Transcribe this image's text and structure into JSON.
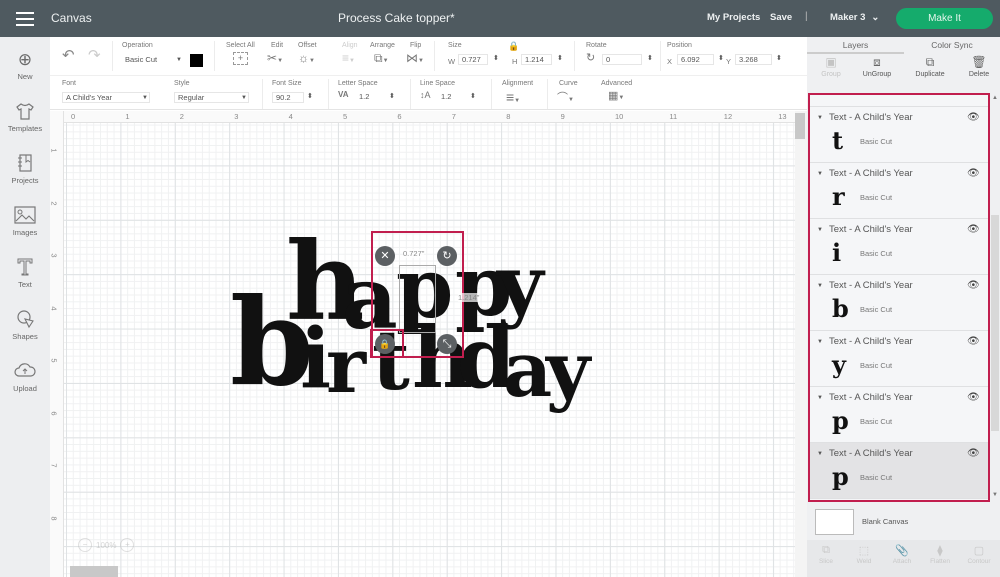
{
  "topbar": {
    "app_title": "Canvas",
    "document_title": "Process Cake topper*",
    "my_projects": "My Projects",
    "save": "Save",
    "separator": "|",
    "machine": "Maker 3",
    "make_it": "Make It",
    "make_it_color": "#15ab6c"
  },
  "sidebar": {
    "items": [
      {
        "label": "New",
        "icon": "plus-circle-icon",
        "glyph": "⊕"
      },
      {
        "label": "Templates",
        "icon": "tshirt-icon",
        "glyph": "👕"
      },
      {
        "label": "Projects",
        "icon": "notebook-icon",
        "glyph": "📓"
      },
      {
        "label": "Images",
        "icon": "image-icon",
        "glyph": "🖼"
      },
      {
        "label": "Text",
        "icon": "text-icon",
        "glyph": "T"
      },
      {
        "label": "Shapes",
        "icon": "shapes-icon",
        "glyph": "⬠"
      },
      {
        "label": "Upload",
        "icon": "cloud-upload-icon",
        "glyph": "☁"
      }
    ]
  },
  "toolbar": {
    "operation_label": "Operation",
    "operation_value": "Basic Cut",
    "operation_color": "#000000",
    "select_all": "Select All",
    "edit": "Edit",
    "offset": "Offset",
    "align": "Align",
    "arrange": "Arrange",
    "flip": "Flip",
    "size_label": "Size",
    "w_label": "W",
    "w_value": "0.727",
    "h_label": "H",
    "h_value": "1.214",
    "rotate_label": "Rotate",
    "rotate_value": "0",
    "position_label": "Position",
    "x_label": "X",
    "x_value": "6.092",
    "y_label": "Y",
    "y_value": "3.268",
    "font_label": "Font",
    "font_value": "A Child's Year",
    "style_label": "Style",
    "style_value": "Regular",
    "font_size_label": "Font Size",
    "font_size_value": "90.2",
    "letter_space_label": "Letter Space",
    "letter_space_value": "1.2",
    "line_space_label": "Line Space",
    "line_space_value": "1.2",
    "alignment_label": "Alignment",
    "curve_label": "Curve",
    "advanced_label": "Advanced"
  },
  "rulers": {
    "horizontal": [
      "0",
      "1",
      "2",
      "3",
      "4",
      "5",
      "6",
      "7",
      "8",
      "9",
      "10",
      "11",
      "12",
      "13"
    ],
    "vertical": [
      "1",
      "2",
      "3",
      "4",
      "5",
      "6",
      "7",
      "8"
    ]
  },
  "canvas": {
    "line1": [
      "h",
      "a",
      "p",
      "p",
      "y"
    ],
    "line2": [
      "b",
      "i",
      "r",
      "t",
      "h",
      "d",
      "a",
      "y"
    ],
    "selection_width": "0.727\"",
    "selection_height": "1.214\"",
    "zoom_level": "100%"
  },
  "layers_panel": {
    "tabs": [
      "Layers",
      "Color Sync"
    ],
    "actions": [
      {
        "label": "Group",
        "enabled": false
      },
      {
        "label": "UnGroup",
        "enabled": true
      },
      {
        "label": "Duplicate",
        "enabled": true
      },
      {
        "label": "Delete",
        "enabled": true
      }
    ],
    "partial_layer_glyph": "h",
    "layers": [
      {
        "name": "Text - A Child's Year",
        "glyph": "t",
        "operation": "Basic Cut"
      },
      {
        "name": "Text - A Child's Year",
        "glyph": "r",
        "operation": "Basic Cut"
      },
      {
        "name": "Text - A Child's Year",
        "glyph": "i",
        "operation": "Basic Cut"
      },
      {
        "name": "Text - A Child's Year",
        "glyph": "b",
        "operation": "Basic Cut"
      },
      {
        "name": "Text - A Child's Year",
        "glyph": "y",
        "operation": "Basic Cut"
      },
      {
        "name": "Text - A Child's Year",
        "glyph": "p",
        "operation": "Basic Cut"
      },
      {
        "name": "Text - A Child's Year",
        "glyph": "p",
        "operation": "Basic Cut",
        "selected": true
      }
    ],
    "blank_canvas": "Blank Canvas",
    "bottom_actions": [
      "Slice",
      "Weld",
      "Attach",
      "Flatten",
      "Contour"
    ],
    "highlight_color": "#c11e4e"
  }
}
